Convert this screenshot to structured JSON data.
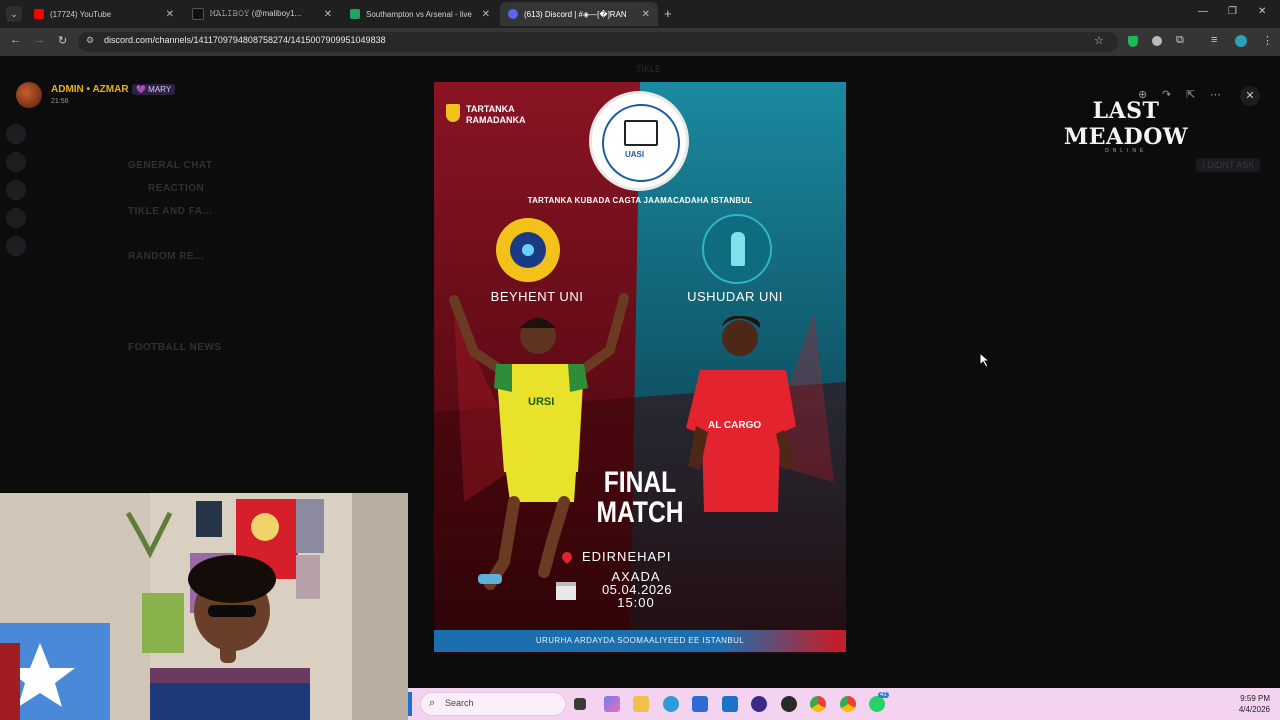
{
  "browser": {
    "tabs": [
      {
        "label": "(17724) YouTube",
        "favicon_color": "#ff0000"
      },
      {
        "label": "𝙼𝙰𝙻𝙸𝙱𝙾𝚈 (@maliboy1...",
        "favicon_color": "#111111"
      },
      {
        "label": "Southampton vs Arsenal - live",
        "favicon_color": "#1fa463"
      },
      {
        "label": "(613) Discord | #◈—[�]RAN",
        "favicon_color": "#5865f2"
      }
    ],
    "url": "discord.com/channels/1411709794808758274/1415007909951049838"
  },
  "discord": {
    "author": "ADMIN • AZMAR",
    "author_tag": "💜 MARY",
    "time": "21:56",
    "channels": [
      "GENERAL CHAT",
      "REACTION",
      "TIKLE AND FA...",
      "RANDOM RE...",
      "FOOTBALL NEWS"
    ],
    "top_channel": "TIKLE",
    "pill": "I DIDNT ASK"
  },
  "poster": {
    "trophy_label": "TARTANKA\nRAMADANKA",
    "seal_label": "UASI",
    "tournament_line": "TARTANKA KUBADA CAGTA JAAMACADAHA ISTANBUL",
    "team_left": "BEYHENT UNI",
    "team_right": "USHUDAR UNI",
    "final_line1": "FINAL",
    "final_line2": "MATCH",
    "venue": "EDIRNEHAPI",
    "day": "AXADA",
    "date": "05.04.2026",
    "time": "15:00",
    "footer": "URURHA ARDAYDA SOOMAALIYEED EE ISTANBUL",
    "left_jersey_text": "URSI",
    "right_jersey_text": "AL CARGO"
  },
  "overlay": {
    "brand": "LAST MEADOW",
    "brand_sub": "ONLINE"
  },
  "taskbar": {
    "search_placeholder": "Search",
    "clock_time": "9:59 PM",
    "clock_date": "4/4/2026",
    "badge": "41"
  },
  "colors": {
    "poster_left": "#7a0f1c",
    "poster_right": "#137a8a",
    "footer_bg": "#1b6fae",
    "accent_gold": "#f2c21a",
    "taskbar": "#f3d3ef"
  }
}
